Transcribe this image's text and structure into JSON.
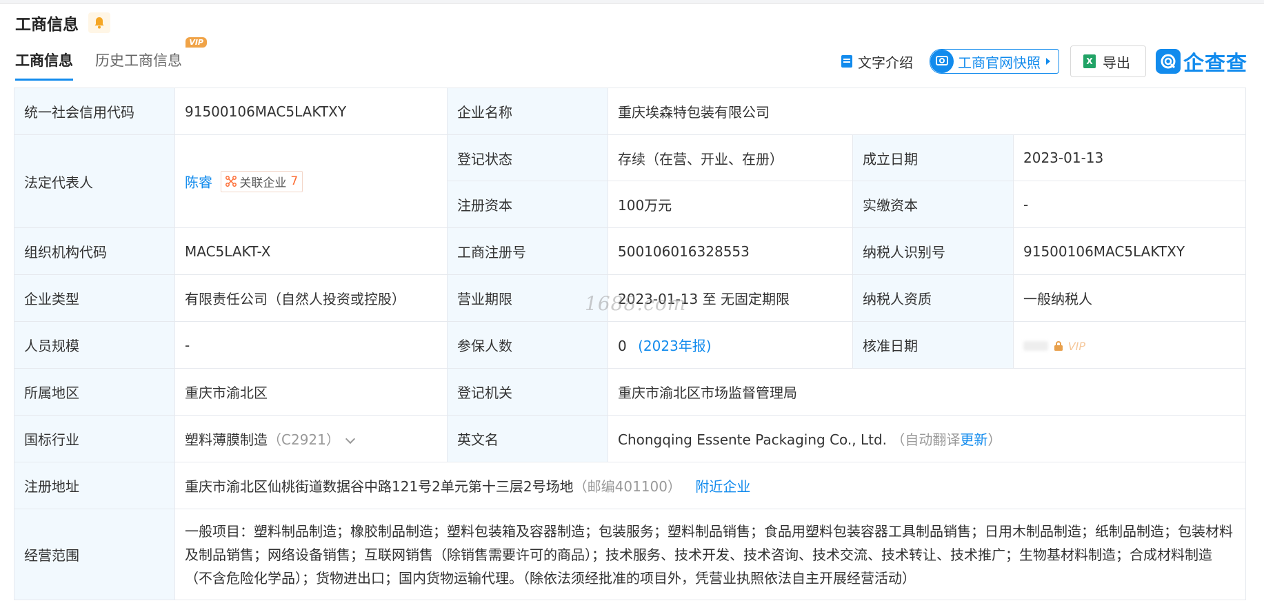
{
  "header": {
    "title": "工商信息"
  },
  "tabs": [
    {
      "label": "工商信息",
      "active": true
    },
    {
      "label": "历史工商信息",
      "badge": "VIP"
    }
  ],
  "toolbar": {
    "text_intro": "文字介绍",
    "snapshot": "工商官网快照",
    "export": "导出",
    "logo": "企查查"
  },
  "info": {
    "credit_code_label": "统一社会信用代码",
    "credit_code": "91500106MAC5LAKTXY",
    "company_name_label": "企业名称",
    "company_name": "重庆埃森特包装有限公司",
    "legal_rep_label": "法定代表人",
    "legal_rep": "陈睿",
    "related_label": "关联企业",
    "related_count": "7",
    "reg_status_label": "登记状态",
    "reg_status": "存续（在营、开业、在册）",
    "founded_label": "成立日期",
    "founded": "2023-01-13",
    "reg_capital_label": "注册资本",
    "reg_capital": "100万元",
    "paid_capital_label": "实缴资本",
    "paid_capital": "-",
    "org_code_label": "组织机构代码",
    "org_code": "MAC5LAKT-X",
    "reg_no_label": "工商注册号",
    "reg_no": "500106016328553",
    "taxpayer_id_label": "纳税人识别号",
    "taxpayer_id": "91500106MAC5LAKTXY",
    "company_type_label": "企业类型",
    "company_type": "有限责任公司（自然人投资或控股）",
    "term_label": "营业期限",
    "term": "2023-01-13 至 无固定期限",
    "tax_qual_label": "纳税人资质",
    "tax_qual": "一般纳税人",
    "staff_size_label": "人员规模",
    "staff_size": "-",
    "insured_label": "参保人数",
    "insured": "0",
    "insured_year": "(2023年报)",
    "approve_date_label": "核准日期",
    "approve_vip": "VIP",
    "region_label": "所属地区",
    "region": "重庆市渝北区",
    "authority_label": "登记机关",
    "authority": "重庆市渝北区市场监督管理局",
    "industry_label": "国标行业",
    "industry": "塑料薄膜制造",
    "industry_code": "（C2921）",
    "english_name_label": "英文名",
    "english_name": "Chongqing Essente Packaging Co., Ltd.",
    "english_note_pre": "（自动翻译",
    "english_note_link": "更新",
    "english_note_post": "）",
    "address_label": "注册地址",
    "address": "重庆市渝北区仙桃街道数据谷中路121号2单元第十三层2号场地",
    "postcode": "（邮编401100）",
    "nearby": "附近企业",
    "scope_label": "经营范围",
    "scope": "一般项目：塑料制品制造；橡胶制品制造；塑料包装箱及容器制造；包装服务；塑料制品销售；食品用塑料包装容器工具制品销售；日用木制品制造；纸制品制造；包装材料及制品销售；网络设备销售；互联网销售（除销售需要许可的商品）；技术服务、技术开发、技术咨询、技术交流、技术转让、技术推广；生物基材料制造；合成材料制造（不含危险化学品）；货物进出口；国内货物运输代理。（除依法须经批准的项目外，凭营业执照依法自主开展经营活动）"
  },
  "watermark": "1688.com"
}
